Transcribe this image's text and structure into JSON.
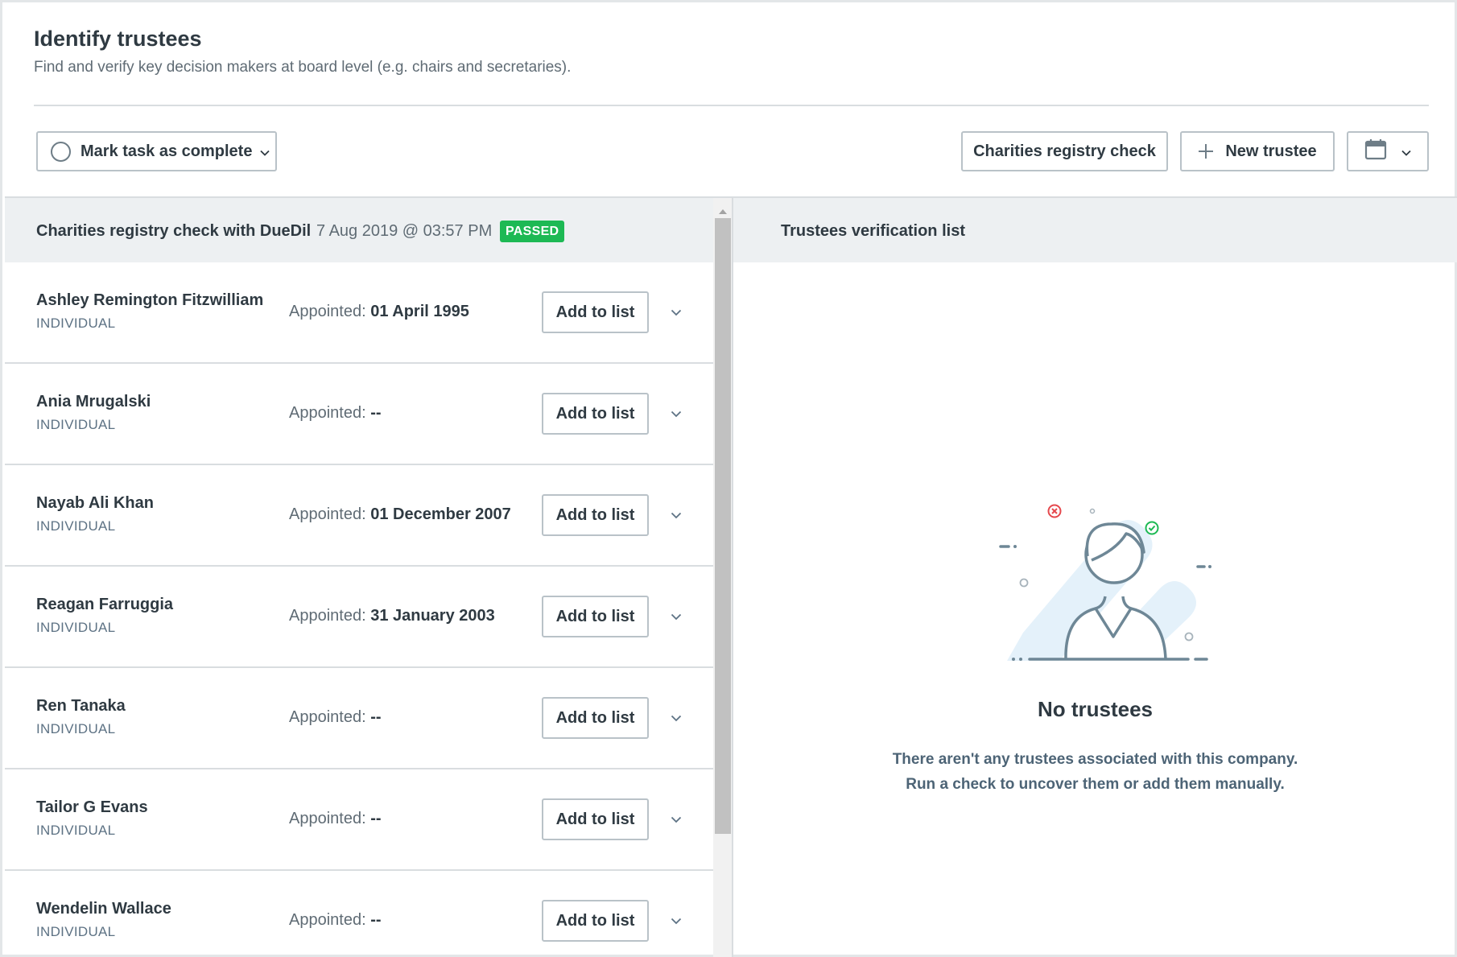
{
  "header": {
    "title": "Identify trustees",
    "subtitle": "Find and verify key decision makers at board level (e.g. chairs and secretaries)."
  },
  "toolbar": {
    "complete_label": "Mark task as complete",
    "registry_label": "Charities registry check",
    "new_label": "New trustee"
  },
  "check": {
    "title": "Charities registry check with DueDil",
    "date": "7 Aug 2019 @ 03:57 PM",
    "status": "PASSED",
    "status_color": "#1db954"
  },
  "trustees": [
    {
      "name": "Ashley Remington Fitzwilliam",
      "type": "INDIVIDUAL",
      "appointed_label": "Appointed:",
      "appointed": "01 April 1995",
      "action": "Add to list"
    },
    {
      "name": "Ania Mrugalski",
      "type": "INDIVIDUAL",
      "appointed_label": "Appointed:",
      "appointed": "--",
      "action": "Add to list"
    },
    {
      "name": "Nayab Ali Khan",
      "type": "INDIVIDUAL",
      "appointed_label": "Appointed:",
      "appointed": "01 December 2007",
      "action": "Add to list"
    },
    {
      "name": "Reagan Farruggia",
      "type": "INDIVIDUAL",
      "appointed_label": "Appointed:",
      "appointed": "31 January 2003",
      "action": "Add to list"
    },
    {
      "name": "Ren Tanaka",
      "type": "INDIVIDUAL",
      "appointed_label": "Appointed:",
      "appointed": "--",
      "action": "Add to list"
    },
    {
      "name": "Tailor G Evans",
      "type": "INDIVIDUAL",
      "appointed_label": "Appointed:",
      "appointed": "--",
      "action": "Add to list"
    },
    {
      "name": "Wendelin Wallace",
      "type": "INDIVIDUAL",
      "appointed_label": "Appointed:",
      "appointed": "--",
      "action": "Add to list"
    }
  ],
  "verification": {
    "title": "Trustees verification list",
    "empty_title": "No trustees",
    "empty_line1": "There aren't any trustees associated with this company.",
    "empty_line2": "Run a check to uncover them or add them manually."
  },
  "icons": {
    "complete": "circle-icon",
    "new": "plus-icon",
    "calendar": "calendar-icon",
    "expand": "chevron-down-icon"
  }
}
